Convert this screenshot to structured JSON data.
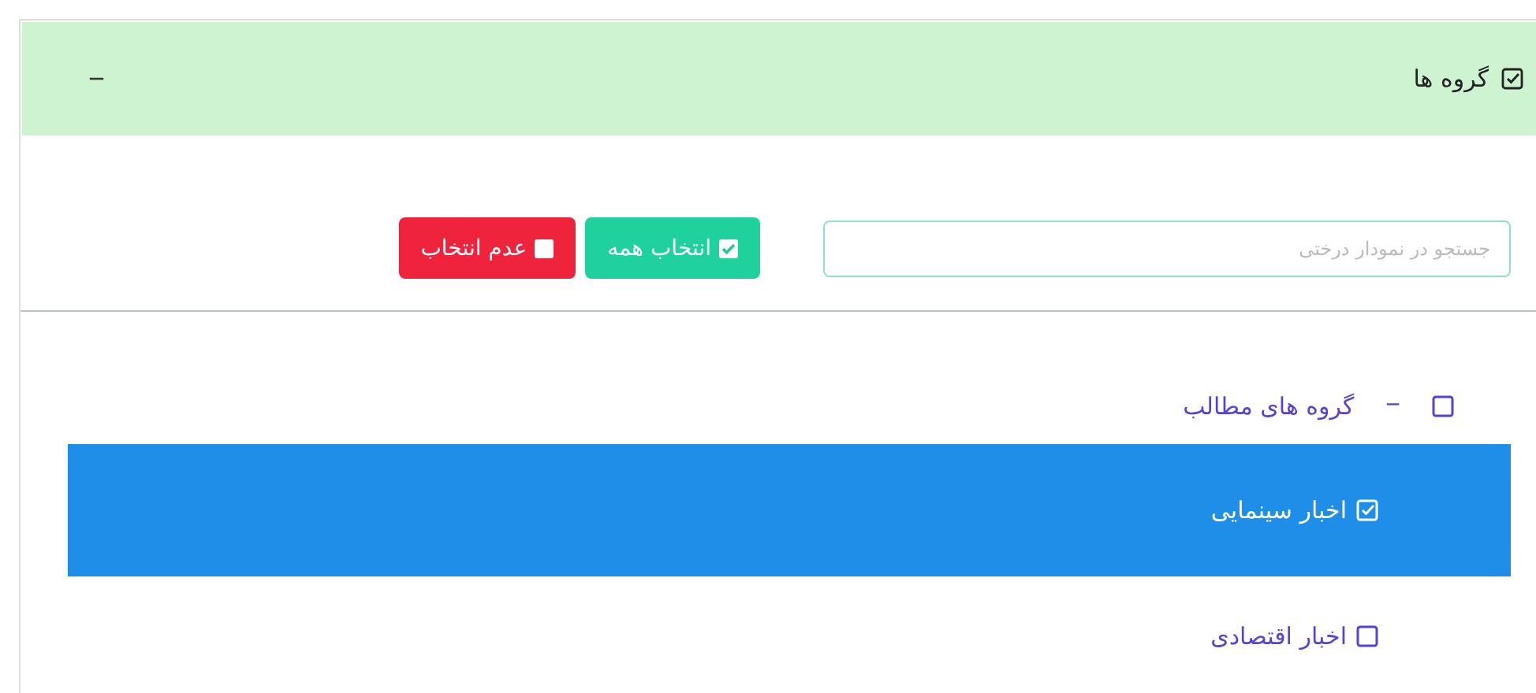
{
  "panel": {
    "title": "گروه ها",
    "collapse_symbol": "−"
  },
  "search": {
    "placeholder": "جستجو در نمودار درختی"
  },
  "buttons": [
    {
      "label": "انتخاب همه",
      "kind": "select_all"
    },
    {
      "label": "عدم انتخاب",
      "kind": "deselect_all"
    }
  ],
  "tree": [
    {
      "label": "گروه های مطالب",
      "checked": false,
      "expanded": true,
      "toggle": "−",
      "children": [
        {
          "label": "اخبار سینمایی",
          "checked": true,
          "selected": true
        },
        {
          "label": "اخبار اقتصادی",
          "checked": false,
          "selected": false
        }
      ]
    }
  ]
}
